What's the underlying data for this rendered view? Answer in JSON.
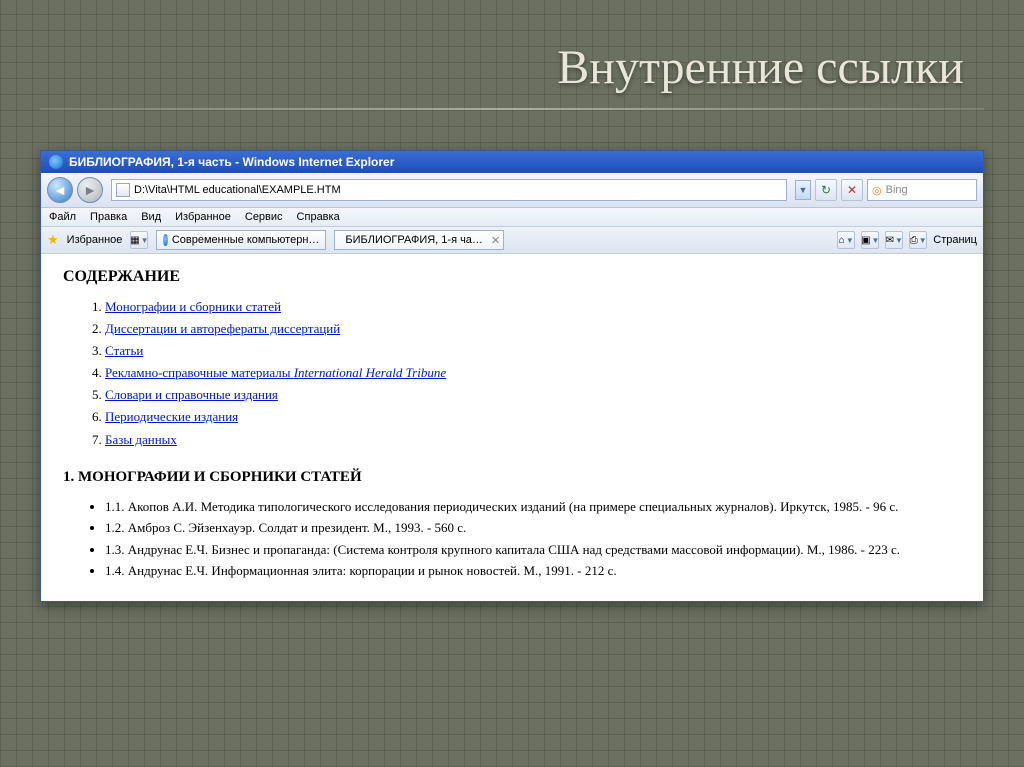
{
  "slide": {
    "title": "Внутренние ссылки"
  },
  "browser": {
    "window_title": "БИБЛИОГРАФИЯ, 1-я часть - Windows Internet Explorer",
    "address": "D:\\Vita\\HTML educational\\EXAMPLE.HTM",
    "search_placeholder": "Bing",
    "menu": {
      "file": "Файл",
      "edit": "Правка",
      "view": "Вид",
      "favorites": "Избранное",
      "tools": "Сервис",
      "help": "Справка"
    },
    "favorites_label": "Избранное",
    "tabs": [
      {
        "label": "Современные компьютерн…"
      },
      {
        "label": "БИБЛИОГРАФИЯ, 1-я ча…"
      }
    ],
    "pages_label": "Страниц"
  },
  "page": {
    "heading1": "СОДЕРЖАНИЕ",
    "toc": [
      {
        "text": "Монографии и сборники статей"
      },
      {
        "text": "Диссертации и авторефераты диссертаций"
      },
      {
        "text": "Статьи"
      },
      {
        "text_prefix": "Рекламно-справочные материалы ",
        "text_em": "International Herald Tribune"
      },
      {
        "text": "Словари и справочные издания"
      },
      {
        "text": "Периодические издания"
      },
      {
        "text": "Базы данных"
      }
    ],
    "heading2": "1. МОНОГРАФИИ И СБОРНИКИ СТАТЕЙ",
    "items": [
      "1.1. Акопов А.И. Методика типологического исследования периодических изданий (на примере специальных журналов). Иркутск, 1985. - 96 с.",
      "1.2. Амброз С. Эйзенхауэр. Солдат и президент. М., 1993. - 560 с.",
      "1.3. Андрунас Е.Ч. Бизнес и пропаганда: (Система контроля крупного капитала США над средствами массовой информации). М., 1986. - 223 с.",
      "1.4. Андрунас Е.Ч. Информационная элита: корпорации и рынок новостей. М., 1991. - 212 с."
    ]
  }
}
